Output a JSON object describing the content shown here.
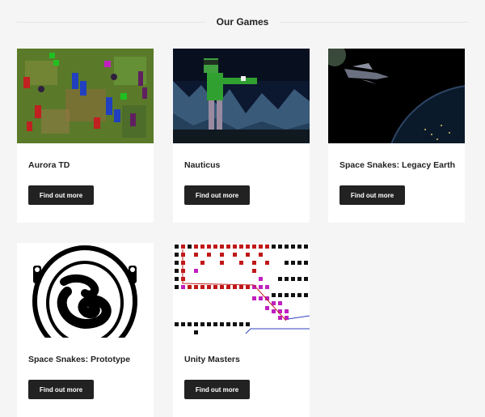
{
  "section": {
    "title": "Our Games"
  },
  "games": [
    {
      "name": "Aurora TD",
      "button_label": "Find out more",
      "thumbnail": "aurora-td-screenshot"
    },
    {
      "name": "Nauticus",
      "button_label": "Find out more",
      "thumbnail": "nauticus-screenshot"
    },
    {
      "name": "Space Snakes: Legacy Earth",
      "button_label": "Find out more",
      "thumbnail": "space-snakes-legacy-earth-screenshot"
    },
    {
      "name": "Space Snakes: Prototype",
      "button_label": "Find out more",
      "thumbnail": "space-snakes-prototype-logo"
    },
    {
      "name": "Unity Masters",
      "button_label": "Find out more",
      "thumbnail": "unity-masters-screenshot"
    }
  ],
  "colors": {
    "background": "#f5f5f5",
    "card": "#ffffff",
    "button": "#222222",
    "button_text": "#ffffff"
  }
}
